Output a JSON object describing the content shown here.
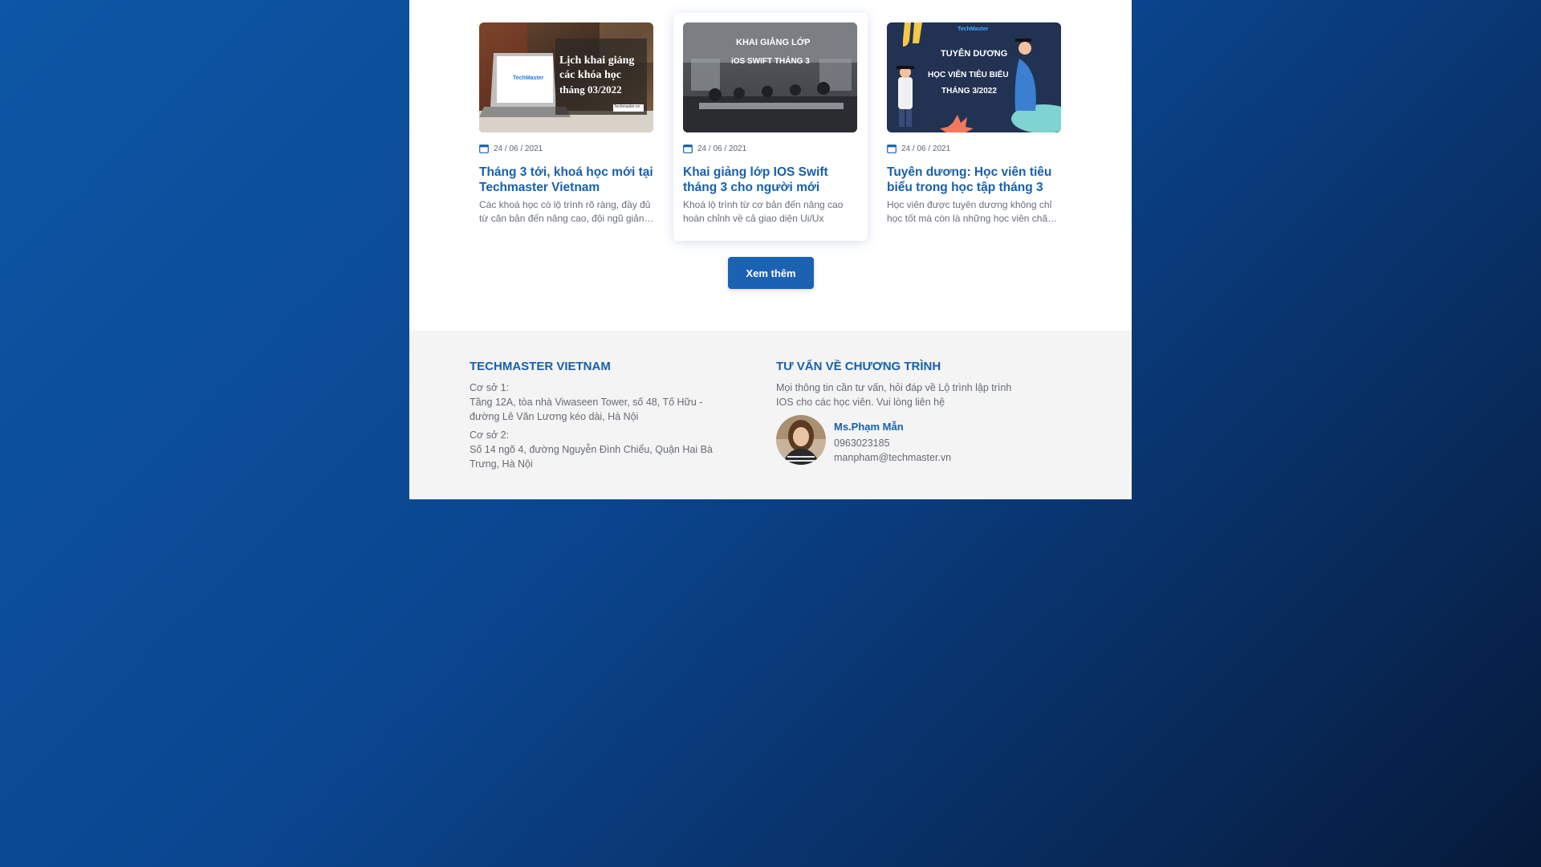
{
  "news": {
    "cards": [
      {
        "date": "24 / 06 / 2021",
        "title": "Tháng 3 tới, khoá học mới tại Techmaster Vietnam",
        "desc": "Các khoá học có lộ trình rõ ràng, đầy đủ từ căn bản đến nâng cao, đội ngũ giảng viên",
        "image": {
          "line1": "Lịch khai giảng",
          "line2": "các khóa học",
          "line3": "tháng 03/2022",
          "brand": "TechMaster",
          "tag": "Techmaster.vn"
        }
      },
      {
        "date": "24 / 06 / 2021",
        "title": "Khai giảng lớp IOS Swift tháng 3 cho người mới",
        "desc": "Khoá lộ trình từ cơ bản đến nâng cao hoàn chỉnh về cả giao diện Ui/Ux",
        "image": {
          "line1": "KHAI GIẢNG LỚP",
          "line2": "iOS SWIFT THÁNG 3"
        }
      },
      {
        "date": "24 / 06 / 2021",
        "title": "Tuyên dương: Học viên tiêu biểu trong học tập tháng 3",
        "desc": "Học viên được tuyên dương không chỉ học tốt mà còn là những học viên chăm chỉ",
        "image": {
          "line1": "TUYÊN DƯƠNG",
          "line2": "HỌC VIÊN TIÊU BIỂU",
          "line3": "THÁNG 3/2022",
          "brand": "TechMaster"
        }
      }
    ],
    "more_label": "Xem thêm"
  },
  "footer": {
    "company": {
      "heading": "TECHMASTER VIETNAM",
      "branch1_label": "Cơ sở 1:",
      "branch1_line1": "Tầng 12A, tòa nhà Viwaseen Tower, số 48, Tố Hữu -",
      "branch1_line2": "đường Lê Văn Lương kéo dài, Hà Nội",
      "branch2_label": "Cơ sở 2:",
      "branch2_line1": "Số 14 ngõ 4, đường Nguyễn Đình Chiểu, Quận Hai Bà",
      "branch2_line2": "Trưng, Hà Nội"
    },
    "consult": {
      "heading": "TƯ VẤN VỀ CHƯƠNG TRÌNH",
      "intro_line1": "Mọi thông tin cần tư vấn, hỏi đáp về Lộ trình lập trình",
      "intro_line2": "IOS cho các học viên. Vui lòng liên hệ",
      "name": "Ms.Phạm Mẫn",
      "phone": "0963023185",
      "email": "manpham@techmaster.vn"
    }
  },
  "colors": {
    "accent": "#1660ad",
    "button": "#1c62b3",
    "footer_bg": "#f4f4f4"
  }
}
